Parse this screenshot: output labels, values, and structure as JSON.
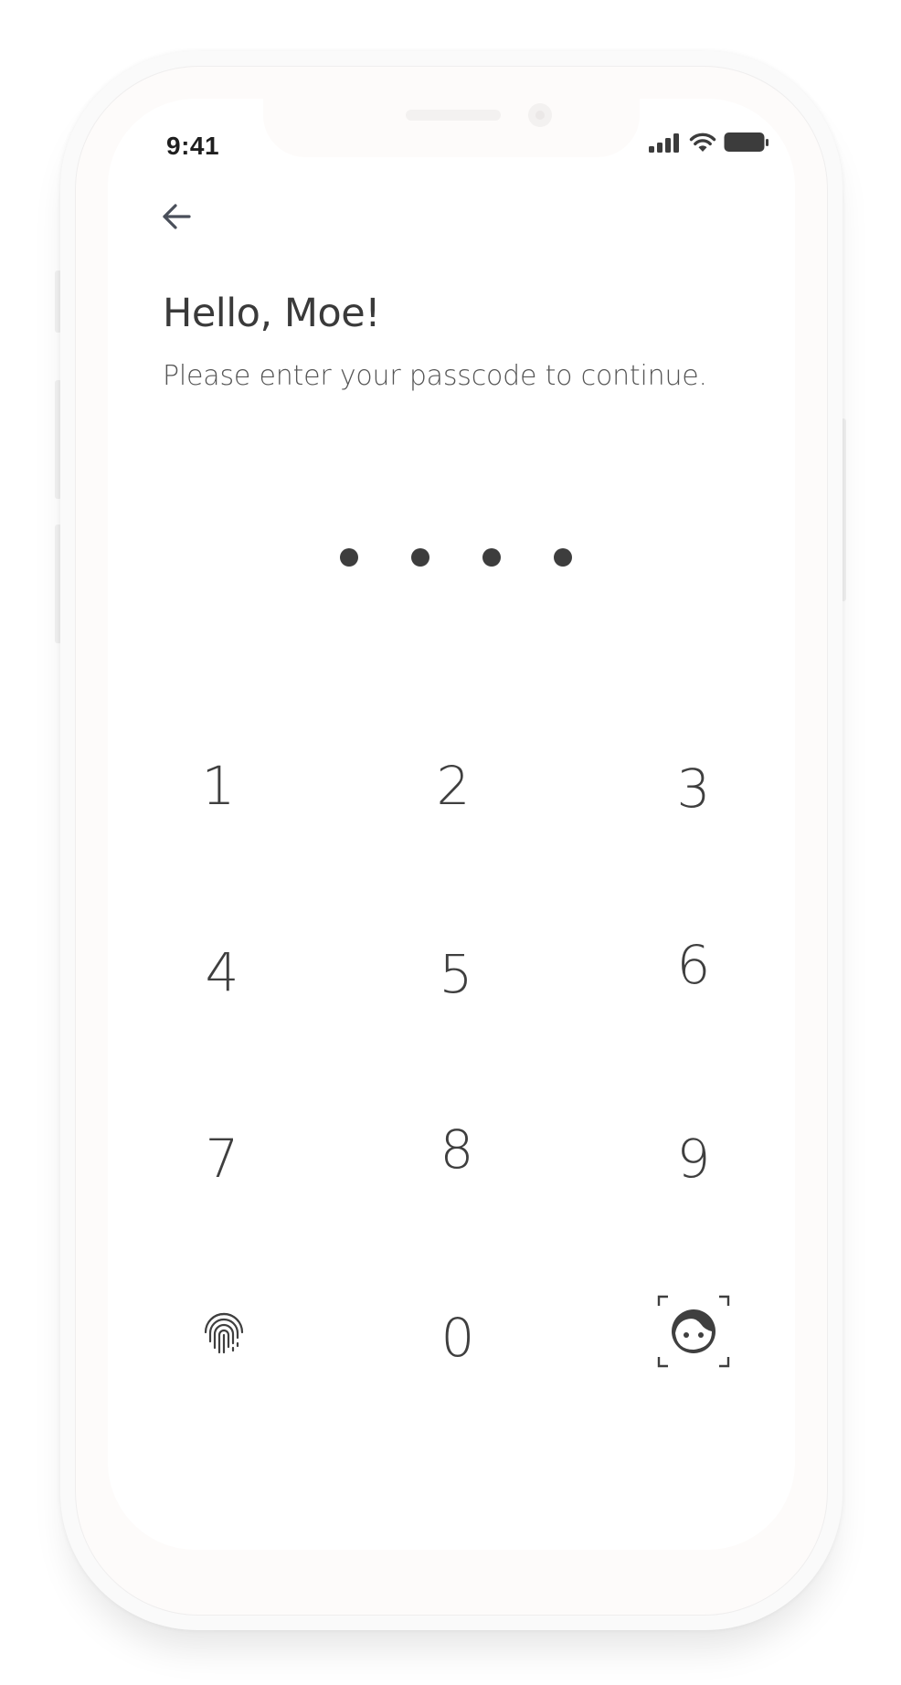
{
  "status_bar": {
    "time": "9:41",
    "icons": [
      "signal-icon",
      "wifi-icon",
      "battery-icon"
    ]
  },
  "header": {
    "back_icon": "arrow-left-icon"
  },
  "main": {
    "greeting": "Hello, Moe!",
    "subtitle": "Please enter your passcode to continue.",
    "passcode_filled": 4,
    "passcode_length": 4
  },
  "keypad": {
    "keys": [
      "1",
      "2",
      "3",
      "4",
      "5",
      "6",
      "7",
      "8",
      "9",
      "0"
    ],
    "fingerprint_icon": "fingerprint-icon",
    "face_id_icon": "face-id-icon"
  },
  "colors": {
    "text_primary": "#3a3a3a",
    "text_secondary": "#555555",
    "dot": "#3d3d3d",
    "icon": "#4a4f5a",
    "screen_bg": "#ffffff",
    "frame_bg": "#fdfbfa"
  }
}
